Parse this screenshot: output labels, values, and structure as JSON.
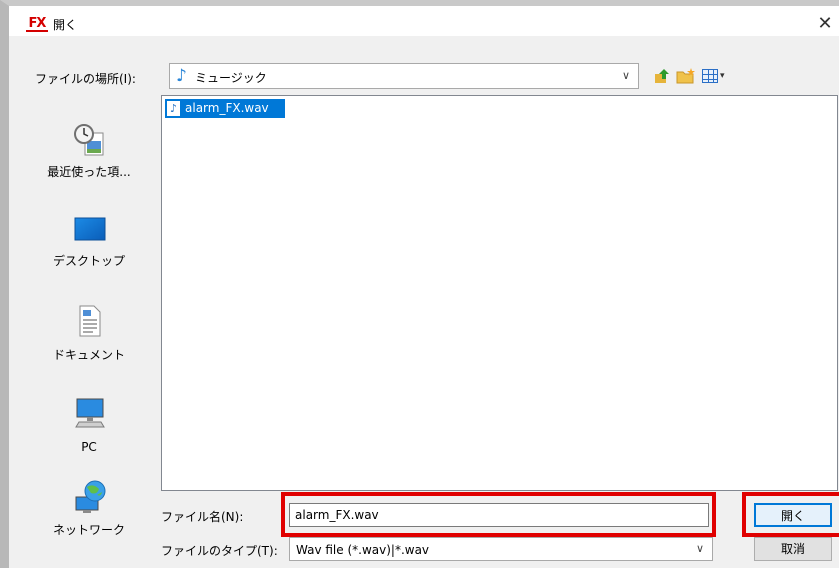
{
  "window": {
    "title": "開く",
    "app_logo": "FX",
    "close_glyph": "✕"
  },
  "toolbar": {
    "look_in_label": "ファイルの場所(I):",
    "look_in_value": "ミュージック",
    "look_in_icon": "music-note-icon",
    "up_icon": "up-folder-icon",
    "new_folder_icon": "new-folder-icon",
    "view_menu_icon": "view-menu-icon"
  },
  "places": [
    {
      "label": "最近使った項...",
      "icon": "recent-items-icon"
    },
    {
      "label": "デスクトップ",
      "icon": "desktop-icon"
    },
    {
      "label": "ドキュメント",
      "icon": "documents-icon"
    },
    {
      "label": "PC",
      "icon": "pc-icon"
    },
    {
      "label": "ネットワーク",
      "icon": "network-icon"
    }
  ],
  "files": [
    {
      "name": "alarm_FX.wav",
      "selected": true,
      "icon": "audio-file-icon"
    }
  ],
  "form": {
    "filename_label": "ファイル名(N):",
    "filename_value": "alarm_FX.wav",
    "filetype_label": "ファイルのタイプ(T):",
    "filetype_value": "Wav file (*.wav)|*.wav"
  },
  "buttons": {
    "open": "開く",
    "cancel": "取消"
  },
  "colors": {
    "highlight": "#e00000",
    "selection": "#0078d7"
  }
}
